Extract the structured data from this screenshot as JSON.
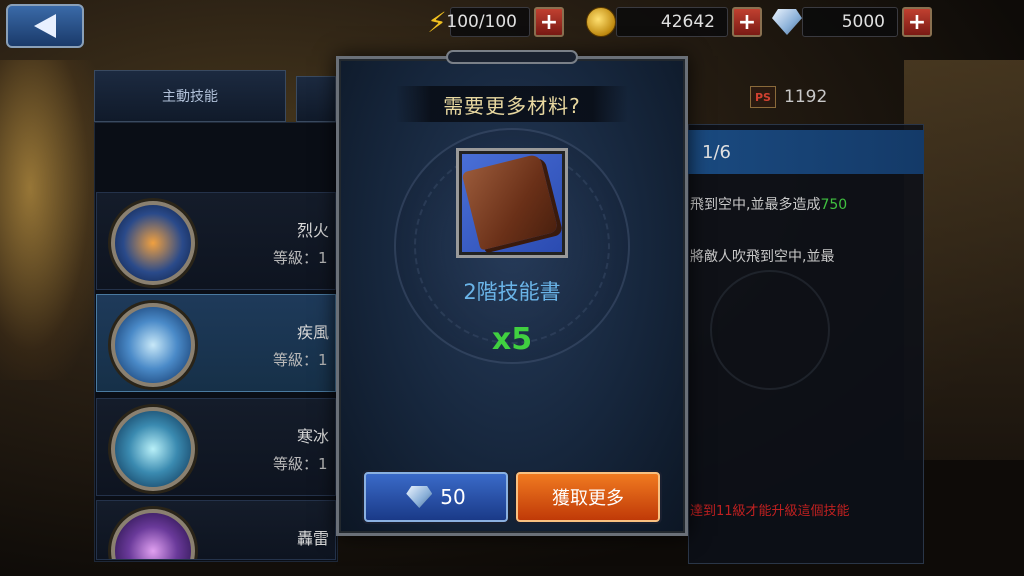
{
  "top": {
    "energy": "100/100",
    "gold": "42642",
    "diamonds": "5000",
    "plus_label": "+"
  },
  "left": {
    "tab_active_label": "主動技能",
    "skills": [
      {
        "name": "烈火",
        "level": "等級：1"
      },
      {
        "name": "疾風",
        "level": "等級：1"
      },
      {
        "name": "寒冰",
        "level": "等級：1"
      },
      {
        "name": "轟雷",
        "level": ""
      }
    ]
  },
  "right": {
    "ps_icon": "PS",
    "ps_value": "1192",
    "header": "1/6",
    "desc1": "飛到空中,並最多造成",
    "desc1_value": "750",
    "desc2": "將敵人吹飛到空中,並最",
    "warning": "達到11級才能升級這個技能"
  },
  "modal": {
    "title": "需要更多材料?",
    "item_name": "2階技能書",
    "item_count": "x5",
    "diamond_cost": "50",
    "get_more_label": "獲取更多"
  },
  "colors": {
    "accent_blue": "#1a4a80",
    "gold_text": "#e8d8a0",
    "green": "#40d040",
    "orange_btn": "#f07a20"
  },
  "icons": {
    "back": "back-arrow-icon",
    "energy": "lightning-icon",
    "gold": "coin-icon",
    "diamond": "diamond-icon"
  }
}
